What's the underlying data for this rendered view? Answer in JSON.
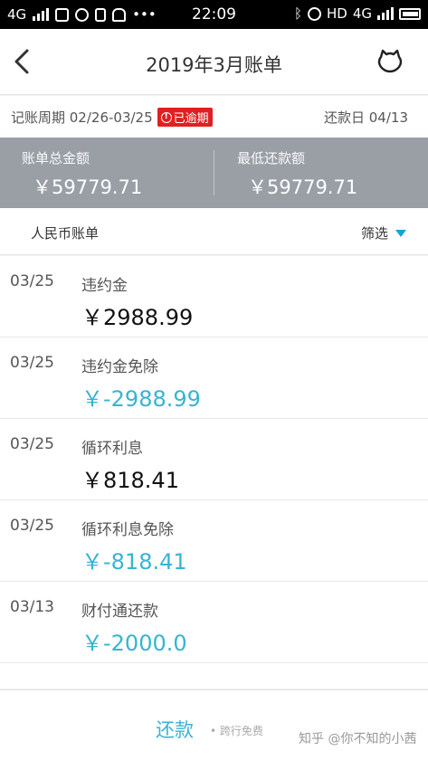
{
  "status_bar": {
    "network": "4G",
    "time": "22:09",
    "hd": "HD",
    "network_right": "4G"
  },
  "nav": {
    "title": "2019年3月账单",
    "back_icon": "chevron-left-icon",
    "service_icon": "customer-service-icon"
  },
  "period": {
    "label": "记账周期 02/26-03/25",
    "overdue": "已逾期",
    "repay_date": "还款日 04/13"
  },
  "summary": {
    "total_label": "账单总金额",
    "total_value": "￥59779.71",
    "min_label": "最低还款额",
    "min_value": "￥59779.71"
  },
  "list_header": {
    "title": "人民币账单",
    "filter": "筛选"
  },
  "transactions": [
    {
      "date": "03/25",
      "title": "违约金",
      "amount": "￥2988.99",
      "type": "debit"
    },
    {
      "date": "03/25",
      "title": "违约金免除",
      "amount": "￥-2988.99",
      "type": "credit"
    },
    {
      "date": "03/25",
      "title": "循环利息",
      "amount": "￥818.41",
      "type": "debit"
    },
    {
      "date": "03/25",
      "title": "循环利息免除",
      "amount": "￥-818.41",
      "type": "credit"
    },
    {
      "date": "03/13",
      "title": "财付通还款",
      "amount": "￥-2000.0",
      "type": "credit"
    }
  ],
  "bottom": {
    "repay": "还款",
    "fee": "• 跨行免费",
    "watermark": "知乎 @你不知的小茜"
  },
  "colors": {
    "accent": "#37b4d2",
    "overdue": "#e02020",
    "summary_bg": "#9a9fa6"
  }
}
